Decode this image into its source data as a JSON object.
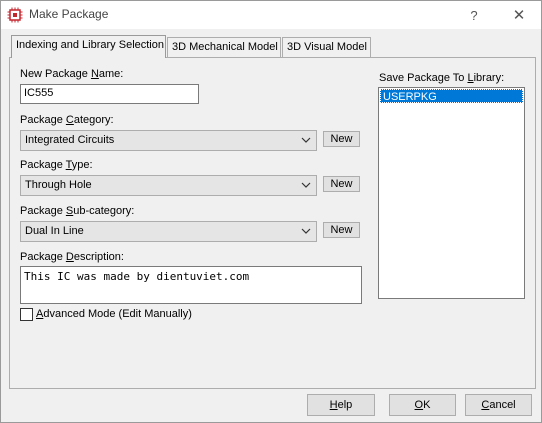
{
  "window": {
    "title": "Make Package",
    "help_glyph": "?",
    "close_glyph": "✕"
  },
  "tabs": [
    {
      "label": "Indexing and Library Selection",
      "active": true
    },
    {
      "label": "3D Mechanical Model",
      "active": false
    },
    {
      "label": "3D Visual Model",
      "active": false
    }
  ],
  "form": {
    "name_label_pre": "New Package ",
    "name_label_u": "N",
    "name_label_post": "ame:",
    "name_value": "IC555",
    "category_label_pre": "Package ",
    "category_label_u": "C",
    "category_label_post": "ategory:",
    "category_value": "Integrated Circuits",
    "type_label_pre": "Package ",
    "type_label_u": "T",
    "type_label_post": "ype:",
    "type_value": "Through Hole",
    "subcat_label_pre": "Package ",
    "subcat_label_u": "S",
    "subcat_label_post": "ub-category:",
    "subcat_value": "Dual In Line",
    "desc_label_pre": "Package ",
    "desc_label_u": "D",
    "desc_label_post": "escription:",
    "desc_value": "This IC was made by dientuviet.com",
    "new_label": "New",
    "advanced_label_pre": "",
    "advanced_label_u": "A",
    "advanced_label_post": "dvanced Mode (Edit Manually)",
    "advanced_checked": false
  },
  "library": {
    "label_pre": "Save Package To ",
    "label_u": "L",
    "label_post": "ibrary:",
    "items": [
      "USERPKG"
    ],
    "selected": "USERPKG"
  },
  "buttons": {
    "help_u": "H",
    "help_post": "elp",
    "ok_u": "O",
    "ok_post": "K",
    "cancel_u": "C",
    "cancel_post": "ancel"
  },
  "colors": {
    "selection": "#0078d7",
    "app_icon": "#c4262e"
  }
}
